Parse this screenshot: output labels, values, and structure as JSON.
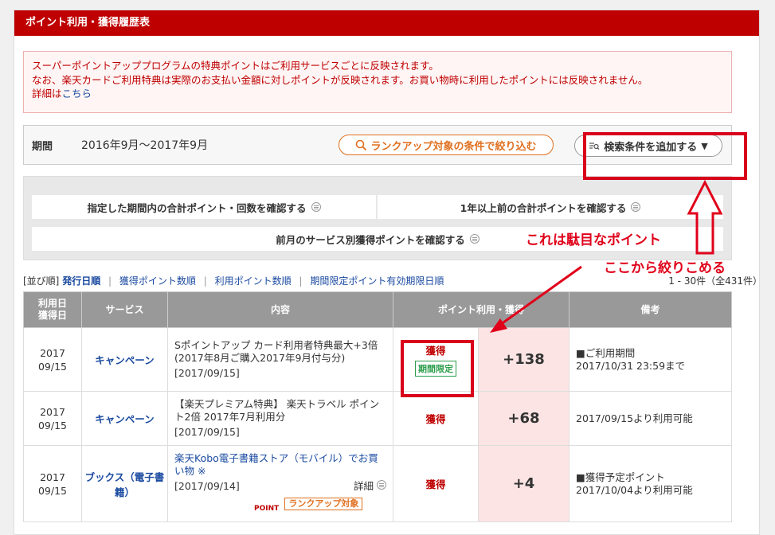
{
  "header": {
    "title": "ポイント利用・獲得履歴表"
  },
  "notice": {
    "line1": "スーパーポイントアッププログラムの特典ポイントはご利用サービスごとに反映されます。",
    "line2": "なお、楽天カードご利用特典は実際のお支払い金額に対しポイントが反映されます。お買い物時に利用したポイントには反映されません。",
    "detail_prefix": "詳細は",
    "detail_link": "こちら"
  },
  "period": {
    "label": "期間",
    "value": "2016年9月〜2017年9月",
    "rank_button": "ランクアップ対象の条件で絞り込む",
    "search_button": "検索条件を追加する"
  },
  "links": {
    "total_in_period": "指定した期間内の合計ポイント・回数を確認する",
    "over_one_year": "1年以上前の合計ポイントを確認する",
    "last_month_by_service": "前月のサービス別獲得ポイントを確認する"
  },
  "sort": {
    "prefix": "[並び順]",
    "options": [
      "発行日順",
      "獲得ポイント数順",
      "利用ポイント数順",
      "期間限定ポイント有効期限日順"
    ],
    "active": "発行日順",
    "count": "1 - 30件（全431件）"
  },
  "table": {
    "headers": {
      "date": "利用日\n獲得日",
      "service": "サービス",
      "content": "内容",
      "points": "ポイント利用・獲得",
      "note": "備考"
    },
    "rows": [
      {
        "year": "2017",
        "md": "09/15",
        "service": "キャンペーン",
        "content": "Sポイントアップ カード利用者特典最大+3倍(2017年8月ご購入2017年9月付与分)",
        "content_date": "[2017/09/15]",
        "type": "獲得",
        "badge": "期間限定",
        "points": "+138",
        "note1": "■ご利用期間",
        "note2": "2017/10/31 23:59まで"
      },
      {
        "year": "2017",
        "md": "09/15",
        "service": "キャンペーン",
        "content": "【楽天プレミアム特典】 楽天トラベル ポイント2倍 2017年7月利用分",
        "content_date": "[2017/09/15]",
        "type": "獲得",
        "points": "+68",
        "note1": "2017/09/15より利用可能"
      },
      {
        "year": "2017",
        "md": "09/15",
        "service": "ブックス（電子書籍）",
        "content": "楽天Kobo電子書籍ストア（モバイル）でお買い物 ※",
        "content_date": "[2017/09/14]",
        "detail": "詳細",
        "point_tag": "POINT",
        "rank_tag": "ランクアップ対象",
        "type": "獲得",
        "points": "+4",
        "note1": "■獲得予定ポイント",
        "note2": "2017/10/04より利用可能"
      }
    ]
  },
  "annotations": {
    "bad_point": "これは駄目なポイント",
    "can_filter": "ここから絞りこめる"
  },
  "colors": {
    "brand": "#bf0000",
    "annotation": "#e0001a",
    "link": "#1a4aa0"
  }
}
